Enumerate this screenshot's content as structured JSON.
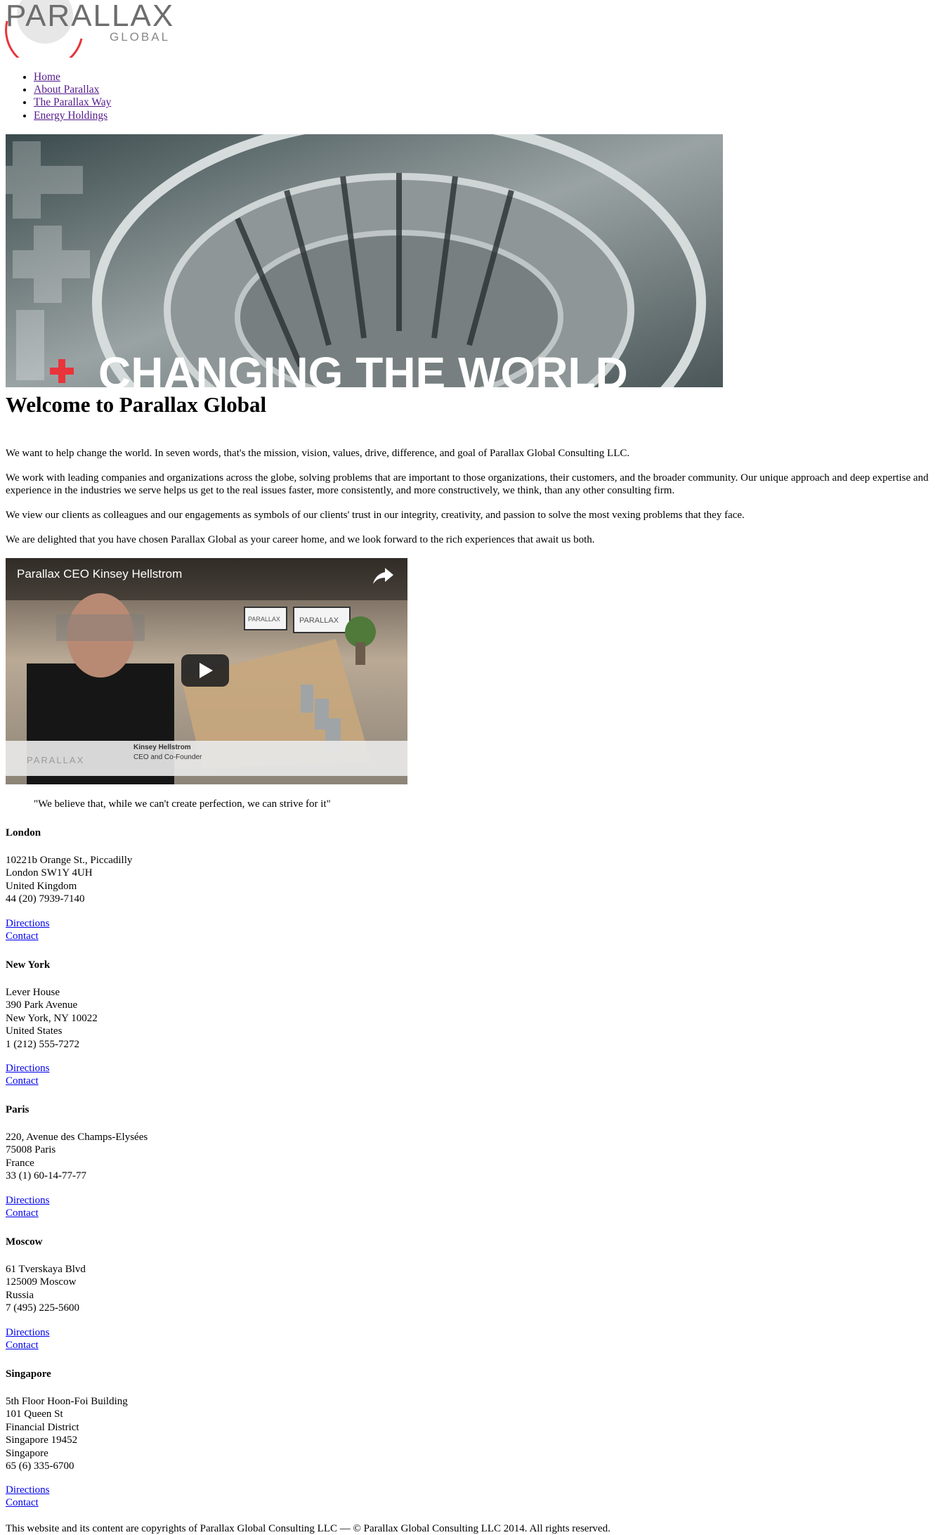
{
  "logo": {
    "name": "PARALLAX",
    "sub": "GLOBAL",
    "mark": "."
  },
  "nav": [
    {
      "label": "Home"
    },
    {
      "label": "About Parallax"
    },
    {
      "label": "The Parallax Way"
    },
    {
      "label": "Energy Holdings"
    }
  ],
  "hero": {
    "banner_text": "CHANGING THE WORLD",
    "accent": "#e8343a"
  },
  "main": {
    "title": "Welcome to Parallax Global",
    "paragraphs": [
      "We want to help change the world. In seven words, that's the mission, vision, values, drive, difference, and goal of Parallax Global Consulting LLC.",
      "We work with leading companies and organizations across the globe, solving problems that are important to those organizations, their customers, and the broader community. Our unique approach and deep expertise and experience in the industries we serve helps us get to the real issues faster, more consistently, and more constructively, we think, than any other consulting firm.",
      "We view our clients as colleagues and our engagements as symbols of our clients' trust in our integrity, creativity, and passion to solve the most vexing problems that they face.",
      "We are delighted that you have chosen Parallax Global as your career home, and we look forward to the rich experiences that await us both."
    ]
  },
  "video": {
    "title": "Parallax CEO Kinsey Hellstrom",
    "lower_third_name": "Kinsey Hellstrom",
    "lower_third_role": "CEO and Co-Founder",
    "lower_third_brand": "PARALLAX",
    "screen_brand": "PARALLAX"
  },
  "quote": "\"We believe that, while we can't create perfection, we can strive for it\"",
  "offices": [
    {
      "city": "London",
      "lines": [
        "10221b Orange St., Piccadilly",
        "London SW1Y 4UH",
        "United Kingdom",
        "44 (20) 7939-7140"
      ],
      "directions": "Directions",
      "contact": "Contact"
    },
    {
      "city": "New York",
      "lines": [
        "Lever House",
        "390 Park Avenue",
        "New York, NY 10022",
        "United States",
        "1 (212) 555-7272"
      ],
      "directions": "Directions",
      "contact": "Contact"
    },
    {
      "city": "Paris",
      "lines": [
        "220, Avenue des Champs-Elysées",
        "75008 Paris",
        "France",
        "33 (1) 60-14-77-77"
      ],
      "directions": "Directions",
      "contact": "Contact"
    },
    {
      "city": "Moscow",
      "lines": [
        "61 Tverskaya Blvd",
        "125009 Moscow",
        "Russia",
        "7 (495) 225-5600"
      ],
      "directions": "Directions",
      "contact": "Contact"
    },
    {
      "city": "Singapore",
      "lines": [
        "5th Floor Hoon-Foi Building",
        "101 Queen St",
        "Financial District",
        "Singapore 19452",
        "Singapore",
        "65 (6) 335-6700"
      ],
      "directions": "Directions",
      "contact": "Contact"
    }
  ],
  "footer": "This website and its content are copyrights of Parallax Global Consulting LLC — © Parallax Global Consulting LLC 2014. All rights reserved."
}
